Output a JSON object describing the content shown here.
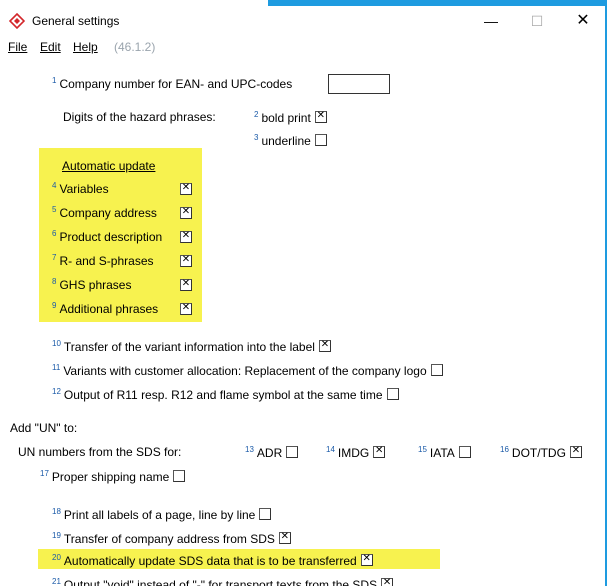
{
  "window": {
    "title": "General settings",
    "minimize_glyph": "—",
    "maximize_glyph": "☐",
    "close_glyph": "✕"
  },
  "menu": {
    "file": "File",
    "edit": "Edit",
    "help": "Help",
    "version": "(46.1.2)"
  },
  "company_number": {
    "num": "1",
    "label": "Company number for EAN- and UPC-codes",
    "value": ""
  },
  "hazard": {
    "label": "Digits of the hazard phrases:",
    "bold_num": "2",
    "bold_label": "bold print",
    "bold_checked": true,
    "underline_num": "3",
    "underline_label": "underline",
    "underline_checked": false
  },
  "auto_update": {
    "heading": "Automatic update",
    "highlight_color": "#f7f24f",
    "items": [
      {
        "num": "4",
        "label": "Variables",
        "checked": true
      },
      {
        "num": "5",
        "label": "Company address",
        "checked": true
      },
      {
        "num": "6",
        "label": "Product description",
        "checked": true
      },
      {
        "num": "7",
        "label": "R- and S-phrases",
        "checked": true
      },
      {
        "num": "8",
        "label": "GHS phrases",
        "checked": true
      },
      {
        "num": "9",
        "label": "Additional phrases",
        "checked": true
      }
    ]
  },
  "options": {
    "o10": {
      "num": "10",
      "label": "Transfer of the variant information into the label",
      "checked": true
    },
    "o11": {
      "num": "11",
      "label": "Variants with customer allocation: Replacement of the company logo",
      "checked": false
    },
    "o12": {
      "num": "12",
      "label": "Output of R11 resp. R12 and flame symbol at the same time",
      "checked": false
    }
  },
  "add_un": {
    "heading": "Add \"UN\" to:",
    "un_label": "UN numbers from the SDS for:",
    "adr": {
      "num": "13",
      "label": "ADR",
      "checked": false
    },
    "imdg": {
      "num": "14",
      "label": "IMDG",
      "checked": true
    },
    "iata": {
      "num": "15",
      "label": "IATA",
      "checked": false
    },
    "dot": {
      "num": "16",
      "label": "DOT/TDG",
      "checked": true
    },
    "shipping": {
      "num": "17",
      "label": "Proper shipping name",
      "checked": false
    }
  },
  "bottom": {
    "o18": {
      "num": "18",
      "label": "Print all labels of a page, line by line",
      "checked": false
    },
    "o19": {
      "num": "19",
      "label": "Transfer of company address from SDS",
      "checked": true
    },
    "o20": {
      "num": "20",
      "label": "Automatically update SDS data that is to be transferred",
      "checked": true
    },
    "o21": {
      "num": "21",
      "label": "Output \"void\" instead of \"-\" for transport texts from the SDS",
      "checked": true
    }
  },
  "colors": {
    "accent_blue": "#1e9be0",
    "highlight_yellow": "#f7f24f",
    "superscript": "#1a5aa8"
  }
}
